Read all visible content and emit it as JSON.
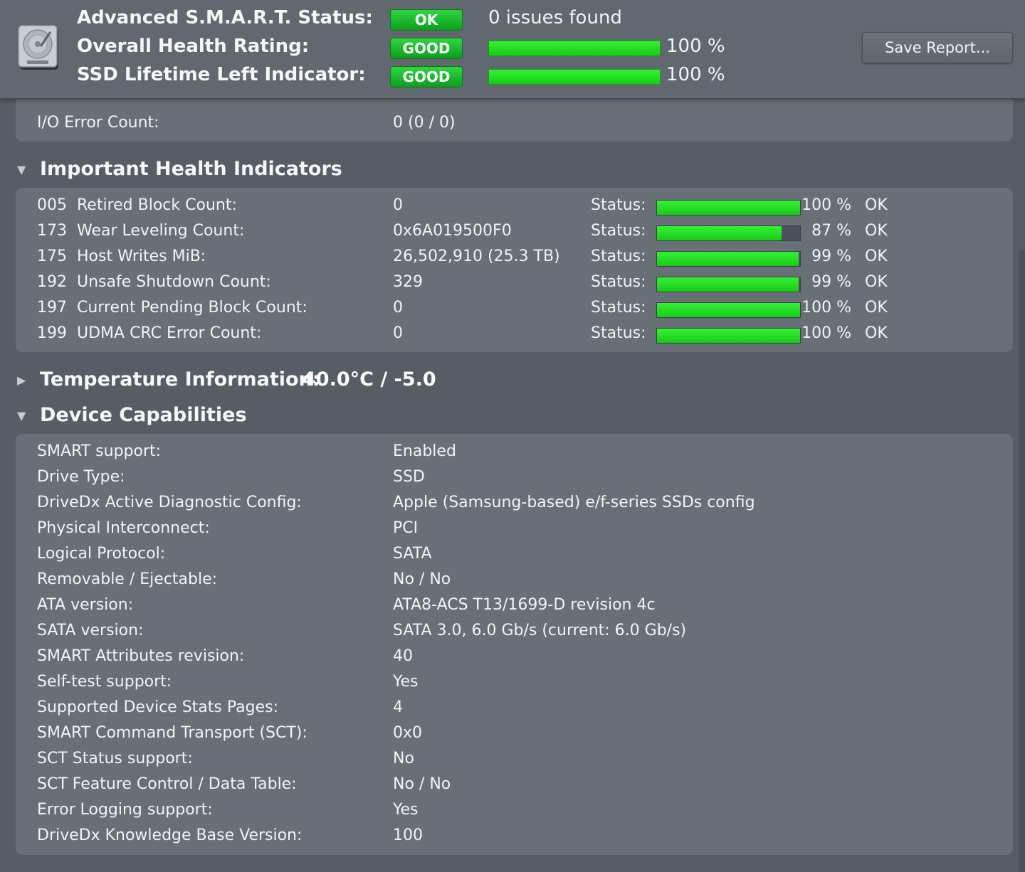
{
  "header": {
    "smart_status": {
      "label": "Advanced S.M.A.R.T. Status:",
      "badge": "OK",
      "text": "0 issues found"
    },
    "health_rating": {
      "label": "Overall Health Rating:",
      "badge": "GOOD",
      "pct": "100 %",
      "level": 1.0
    },
    "lifetime": {
      "label": "SSD Lifetime Left Indicator:",
      "badge": "GOOD",
      "pct": "100 %",
      "level": 1.0
    },
    "save_button": "Save Report..."
  },
  "io_panel": {
    "label": "I/O Error Count:",
    "value": "0  (0 / 0)"
  },
  "health_indicators": {
    "title": "Important Health Indicators",
    "status_label": "Status:",
    "rows": [
      {
        "num": "005",
        "name": "Retired Block Count:",
        "value": "0",
        "pct": "100 %",
        "level": 1.0,
        "status": "OK"
      },
      {
        "num": "173",
        "name": "Wear Leveling Count:",
        "value": "0x6A019500F0",
        "pct": "87 %",
        "level": 0.87,
        "status": "OK"
      },
      {
        "num": "175",
        "name": "Host Writes MiB:",
        "value": "26,502,910 (25.3 TB)",
        "pct": "99 %",
        "level": 0.99,
        "status": "OK"
      },
      {
        "num": "192",
        "name": "Unsafe Shutdown Count:",
        "value": "329",
        "pct": "99 %",
        "level": 0.99,
        "status": "OK"
      },
      {
        "num": "197",
        "name": "Current Pending Block Count:",
        "value": "0",
        "pct": "100 %",
        "level": 1.0,
        "status": "OK"
      },
      {
        "num": "199",
        "name": "UDMA CRC Error Count:",
        "value": "0",
        "pct": "100 %",
        "level": 1.0,
        "status": "OK"
      }
    ]
  },
  "temperature": {
    "title": "Temperature Information:",
    "value": "40.0°C  /  -5.0"
  },
  "capabilities": {
    "title": "Device Capabilities",
    "rows": [
      {
        "label": "SMART support:",
        "value": "Enabled"
      },
      {
        "label": "Drive Type:",
        "value": "SSD"
      },
      {
        "label": "DriveDx Active Diagnostic Config:",
        "value": "Apple (Samsung-based) e/f-series SSDs config"
      },
      {
        "label": "Physical Interconnect:",
        "value": "PCI"
      },
      {
        "label": "Logical Protocol:",
        "value": "SATA"
      },
      {
        "label": "Removable / Ejectable:",
        "value": "No  /  No"
      },
      {
        "label": "ATA version:",
        "value": "ATA8-ACS T13/1699-D revision 4c"
      },
      {
        "label": "SATA version:",
        "value": "SATA 3.0, 6.0 Gb/s (current: 6.0 Gb/s)"
      },
      {
        "label": "SMART Attributes revision:",
        "value": "40"
      },
      {
        "label": "Self-test support:",
        "value": "Yes"
      },
      {
        "label": "Supported Device Stats Pages:",
        "value": "4"
      },
      {
        "label": "SMART Command Transport (SCT):",
        "value": "0x0"
      },
      {
        "label": "SCT Status support:",
        "value": "No"
      },
      {
        "label": "SCT Feature Control / Data Table:",
        "value": "No  /  No"
      },
      {
        "label": "Error Logging support:",
        "value": "Yes"
      },
      {
        "label": "DriveDx Knowledge Base Version:",
        "value": "100"
      }
    ]
  }
}
